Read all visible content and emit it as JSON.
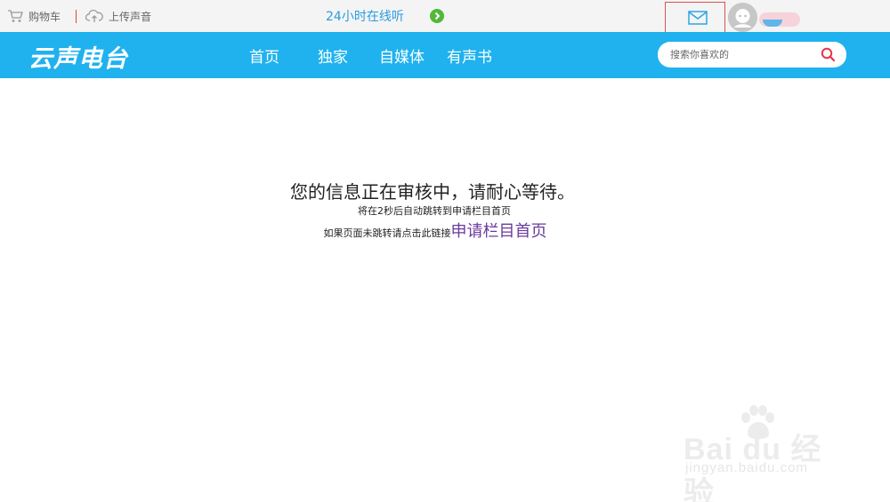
{
  "topbar": {
    "cart_label": "购物车",
    "upload_label": "上传声音",
    "live_label": "24小时在线听"
  },
  "nav": {
    "logo": "云声电台",
    "links": [
      "首页",
      "独家",
      "自媒体",
      "有声书"
    ],
    "search_placeholder": "搜索你喜欢的"
  },
  "notice": {
    "title": "您的信息正在审核中，请耐心等待。",
    "redirect_text": "将在2秒后自动跳转到申请栏目首页",
    "fallback_prefix": "如果页面未跳转请点击此链接",
    "fallback_link": "申请栏目首页"
  },
  "watermark": {
    "brand": "Bai du 经验",
    "url": "jingyan.baidu.com"
  },
  "colors": {
    "nav_bg": "#1fb2ee",
    "topbar_bg": "#f4f4f4",
    "live_text": "#2a9be0",
    "play_button": "#52b83a",
    "link": "#6a3a9e",
    "mail_highlight": "#d9534f",
    "search_icon": "#e8334a"
  },
  "icons": [
    "cart-icon",
    "cloud-upload-icon",
    "play-icon",
    "mail-icon",
    "avatar",
    "search-icon",
    "baidu-paw-icon"
  ]
}
